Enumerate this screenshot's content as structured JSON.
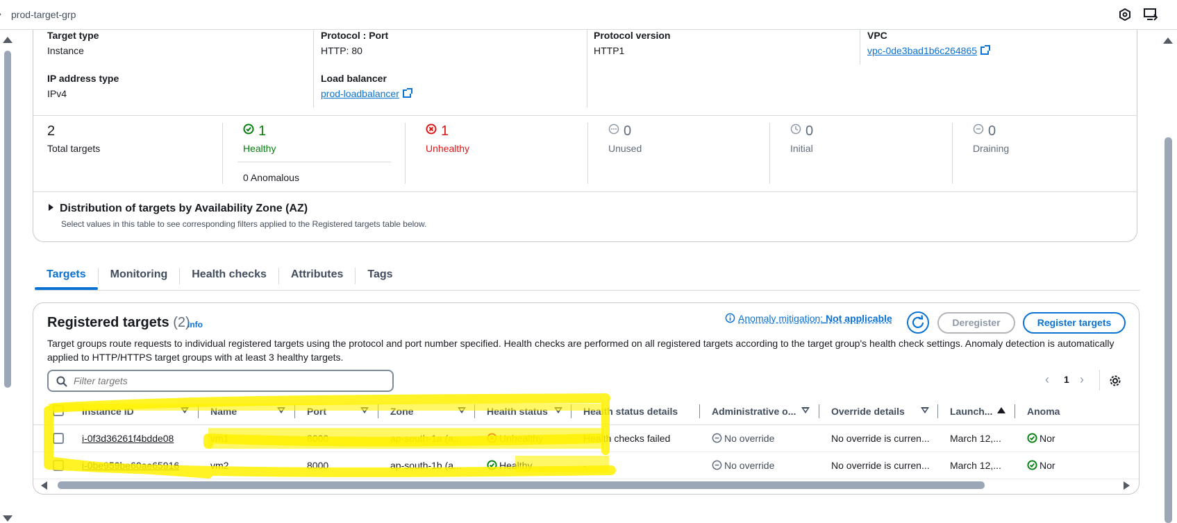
{
  "topbar": {
    "title": "prod-target-grp",
    "icon_left": "chevron-right-icon",
    "icon_1": "settings-hex-icon",
    "icon_2": "screen-share-icon"
  },
  "details": {
    "target_type_label": "Target type",
    "target_type_value": "Instance",
    "protocol_port_label": "Protocol : Port",
    "protocol_port_value": "HTTP: 80",
    "protocol_version_label": "Protocol version",
    "protocol_version_value": "HTTP1",
    "vpc_label": "VPC",
    "vpc_value": "vpc-0de3bad1b6c264865",
    "ip_type_label": "IP address type",
    "ip_type_value": "IPv4",
    "lb_label": "Load balancer",
    "lb_value": "prod-loadbalancer"
  },
  "stats": {
    "total": {
      "num": "2",
      "label": "Total targets"
    },
    "healthy": {
      "num": "1",
      "label": "Healthy",
      "anomalous": "0 Anomalous"
    },
    "unhealthy": {
      "num": "1",
      "label": "Unhealthy"
    },
    "unused": {
      "num": "0",
      "label": "Unused"
    },
    "initial": {
      "num": "0",
      "label": "Initial"
    },
    "draining": {
      "num": "0",
      "label": "Draining"
    }
  },
  "az": {
    "title": "Distribution of targets by Availability Zone (AZ)",
    "desc": "Select values in this table to see corresponding filters applied to the Registered targets table below."
  },
  "tabs": [
    "Targets",
    "Monitoring",
    "Health checks",
    "Attributes",
    "Tags"
  ],
  "registered": {
    "title": "Registered targets",
    "count": "(2)",
    "info": "Info",
    "anomaly_prefix": "Anomaly mitigation:",
    "anomaly_value": "Not applicable",
    "deregister": "Deregister",
    "register": "Register targets",
    "desc": "Target groups route requests to individual registered targets using the protocol and port number specified. Health checks are performed on all registered targets according to the target group's health check settings. Anomaly detection is automatically applied to HTTP/HTTPS target groups with at least 3 healthy targets.",
    "filter_placeholder": "Filter targets",
    "page": "1",
    "columns": [
      "Instance ID",
      "Name",
      "Port",
      "Zone",
      "Health status",
      "Health status details",
      "Administrative o...",
      "Override details",
      "Launch...",
      "Anoma"
    ],
    "rows": [
      {
        "id": "i-0f3d36261f4bdde08",
        "name": "vm1",
        "port": "8000",
        "zone": "ap-south-1a (a...",
        "health": "Unhealthy",
        "details": "Health checks failed",
        "admin": "No override",
        "override": "No override is curren...",
        "launch": "March 12,...",
        "anom": "Nor"
      },
      {
        "id": "i-0be959be60ae65916",
        "name": "vm2",
        "port": "8000",
        "zone": "ap-south-1b (a...",
        "health": "Healthy",
        "details": "-",
        "admin": "No override",
        "override": "No override is curren...",
        "launch": "March 12,...",
        "anom": "Nor"
      }
    ]
  },
  "colors": {
    "accent": "#0972d3",
    "healthy": "#037f0c",
    "unhealthy": "#d91515",
    "highlight": "#fff200"
  }
}
